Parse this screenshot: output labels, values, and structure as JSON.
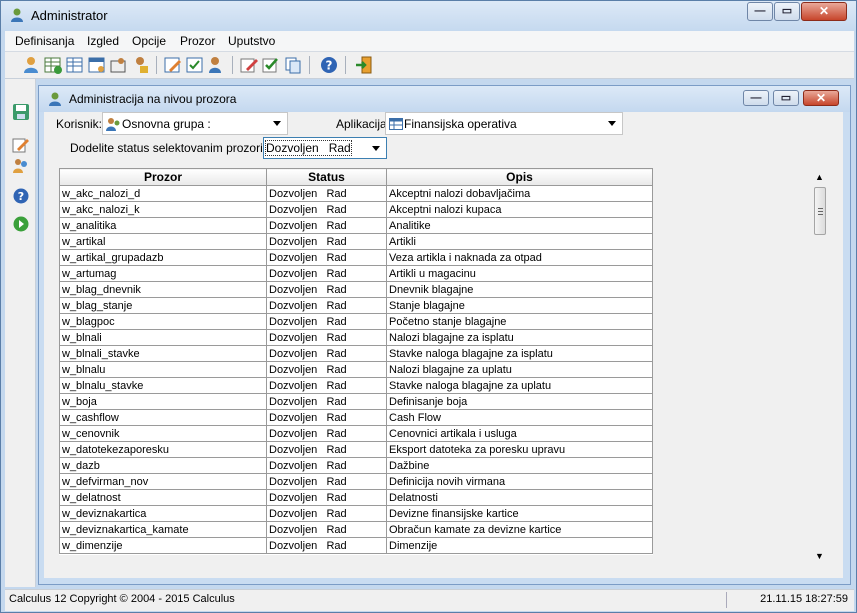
{
  "window": {
    "title": "Administrator"
  },
  "menu": [
    "Definisanja",
    "Izgled",
    "Opcije",
    "Prozor",
    "Uputstvo"
  ],
  "child_window": {
    "title": "Administracija na nivou prozora"
  },
  "filters": {
    "korisnik_label": "Korisnik:",
    "korisnik_value": "Osnovna grupa :",
    "aplikacija_label": "Aplikacija:",
    "aplikacija_value": "Finansijska operativa",
    "status_label": "Dodelite status selektovanim prozorima:",
    "status_value": "Dozvoljen   Rad"
  },
  "table": {
    "columns": [
      "Prozor",
      "Status",
      "Opis"
    ],
    "rows": [
      [
        "w_akc_nalozi_d",
        "Dozvoljen   Rad",
        "Akceptni nalozi dobavljačima"
      ],
      [
        "w_akc_nalozi_k",
        "Dozvoljen   Rad",
        "Akceptni nalozi kupaca"
      ],
      [
        "w_analitika",
        "Dozvoljen   Rad",
        "Analitike"
      ],
      [
        "w_artikal",
        "Dozvoljen   Rad",
        "Artikli"
      ],
      [
        "w_artikal_grupadazb",
        "Dozvoljen   Rad",
        "Veza artikla i naknada za otpad"
      ],
      [
        "w_artumag",
        "Dozvoljen   Rad",
        "Artikli u magacinu"
      ],
      [
        "w_blag_dnevnik",
        "Dozvoljen   Rad",
        "Dnevnik blagajne"
      ],
      [
        "w_blag_stanje",
        "Dozvoljen   Rad",
        "Stanje blagajne"
      ],
      [
        "w_blagpoc",
        "Dozvoljen   Rad",
        "Početno stanje blagajne"
      ],
      [
        "w_blnali",
        "Dozvoljen   Rad",
        "Nalozi blagajne za isplatu"
      ],
      [
        "w_blnali_stavke",
        "Dozvoljen   Rad",
        "Stavke naloga blagajne za isplatu"
      ],
      [
        "w_blnalu",
        "Dozvoljen   Rad",
        "Nalozi blagajne za uplatu"
      ],
      [
        "w_blnalu_stavke",
        "Dozvoljen   Rad",
        "Stavke naloga blagajne za uplatu"
      ],
      [
        "w_boja",
        "Dozvoljen   Rad",
        "Definisanje boja"
      ],
      [
        "w_cashflow",
        "Dozvoljen   Rad",
        "Cash Flow"
      ],
      [
        "w_cenovnik",
        "Dozvoljen   Rad",
        "Cenovnici artikala i usluga"
      ],
      [
        "w_datotekezaporesku",
        "Dozvoljen   Rad",
        "Eksport datoteka za poresku upravu"
      ],
      [
        "w_dazb",
        "Dozvoljen   Rad",
        "Dažbine"
      ],
      [
        "w_defvirman_nov",
        "Dozvoljen   Rad",
        "Definicija novih virmana"
      ],
      [
        "w_delatnost",
        "Dozvoljen   Rad",
        "Delatnosti"
      ],
      [
        "w_deviznakartica",
        "Dozvoljen   Rad",
        "Devizne finansijske kartice"
      ],
      [
        "w_deviznakartica_kamate",
        "Dozvoljen   Rad",
        "Obračun kamate za devizne kartice"
      ],
      [
        "w_dimenzije",
        "Dozvoljen   Rad",
        "Dimenzije"
      ]
    ]
  },
  "status_bar": {
    "left": "Calculus 12  Copyright © 2004 - 2015  Calculus",
    "right": "21.11.15 18:27:59"
  }
}
